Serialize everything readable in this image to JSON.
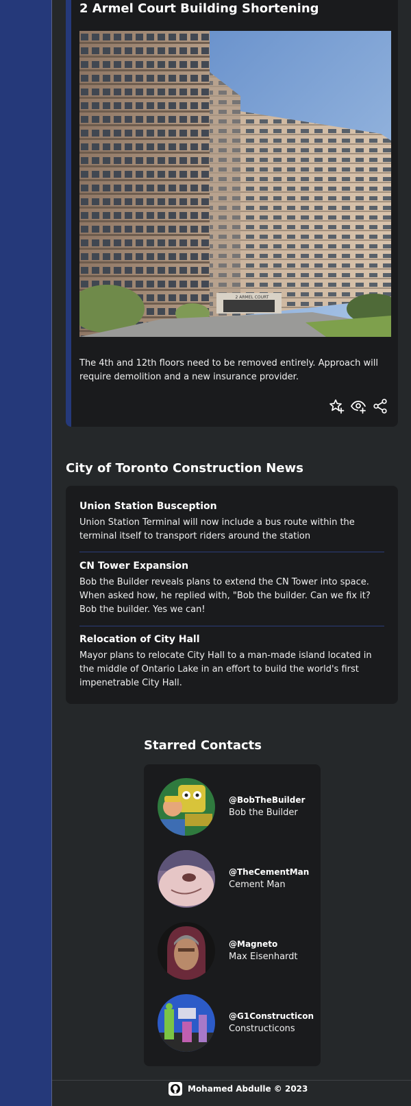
{
  "post": {
    "title": "2 Armel Court Building Shortening",
    "photo_alt": "Apartment building at 2 Armel Court",
    "sign_text": "2 ARMEL COURT",
    "body": "The 4th and 12th floors need to be removed entirely. Approach will require demolition and a new insurance provider.",
    "actions": [
      "star-add-icon",
      "watch-icon",
      "share-icon"
    ]
  },
  "news": {
    "title": "City of Toronto Construction News",
    "items": [
      {
        "headline": "Union Station Busception",
        "text": "Union Station Terminal will now include a bus route within the terminal itself to transport riders around the station"
      },
      {
        "headline": "CN Tower Expansion",
        "text": "Bob the Builder reveals plans to extend the CN Tower into space. When asked how, he replied with, \"Bob the builder. Can we fix it? Bob the builder. Yes we can!"
      },
      {
        "headline": "Relocation of City Hall",
        "text": "Mayor plans to relocate City Hall to a man-made island located in the middle of Ontario Lake in an effort to build the world's first impenetrable City Hall."
      }
    ]
  },
  "contacts": {
    "title": "Starred Contacts",
    "items": [
      {
        "handle": "@BobTheBuilder",
        "name": "Bob the Builder"
      },
      {
        "handle": "@TheCementMan",
        "name": "Cement Man"
      },
      {
        "handle": "@Magneto",
        "name": "Max Eisenhardt"
      },
      {
        "handle": "@G1Constructicon",
        "name": "Constructicons"
      }
    ]
  },
  "footer": {
    "icon": "github-icon",
    "text": "Mohamed Abdulle © 2023"
  },
  "colors": {
    "page_bg": "#25282a",
    "card_bg": "#1a1b1d",
    "accent": "#25397a"
  }
}
